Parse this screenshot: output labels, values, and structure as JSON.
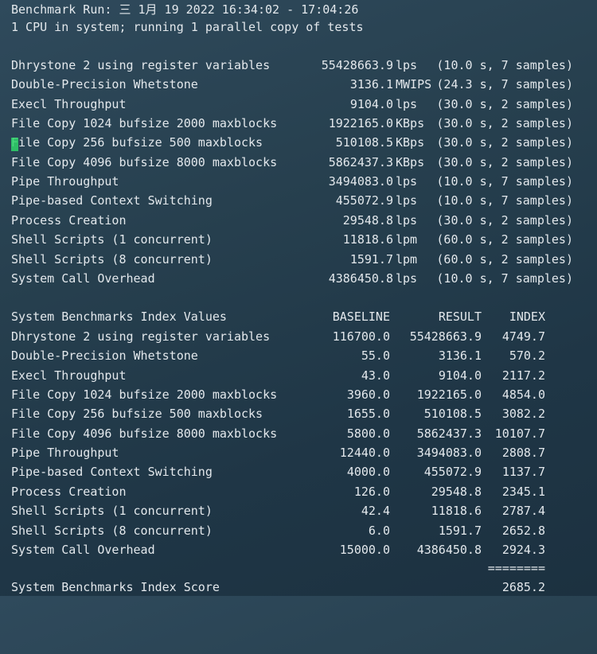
{
  "header": {
    "run_line": "Benchmark Run: 三 1月 19 2022 16:34:02 - 17:04:26",
    "cpu_line": "1 CPU in system; running 1 parallel copy of tests"
  },
  "results": [
    {
      "name": "Dhrystone 2 using register variables",
      "value": "55428663.9",
      "unit": "lps",
      "detail": "(10.0 s, 7 samples)"
    },
    {
      "name": "Double-Precision Whetstone",
      "value": "3136.1",
      "unit": "MWIPS",
      "detail": "(24.3 s, 7 samples)"
    },
    {
      "name": "Execl Throughput",
      "value": "9104.0",
      "unit": "lps",
      "detail": "(30.0 s, 2 samples)"
    },
    {
      "name": "File Copy 1024 bufsize 2000 maxblocks",
      "value": "1922165.0",
      "unit": "KBps",
      "detail": "(30.0 s, 2 samples)"
    },
    {
      "name": "File Copy 256 bufsize 500 maxblocks",
      "value": "510108.5",
      "unit": "KBps",
      "detail": "(30.0 s, 2 samples)"
    },
    {
      "name": "File Copy 4096 bufsize 8000 maxblocks",
      "value": "5862437.3",
      "unit": "KBps",
      "detail": "(30.0 s, 2 samples)"
    },
    {
      "name": "Pipe Throughput",
      "value": "3494083.0",
      "unit": "lps",
      "detail": "(10.0 s, 7 samples)"
    },
    {
      "name": "Pipe-based Context Switching",
      "value": "455072.9",
      "unit": "lps",
      "detail": "(10.0 s, 7 samples)"
    },
    {
      "name": "Process Creation",
      "value": "29548.8",
      "unit": "lps",
      "detail": "(30.0 s, 2 samples)"
    },
    {
      "name": "Shell Scripts (1 concurrent)",
      "value": "11818.6",
      "unit": "lpm",
      "detail": "(60.0 s, 2 samples)"
    },
    {
      "name": "Shell Scripts (8 concurrent)",
      "value": "1591.7",
      "unit": "lpm",
      "detail": "(60.0 s, 2 samples)"
    },
    {
      "name": "System Call Overhead",
      "value": "4386450.8",
      "unit": "lps",
      "detail": "(10.0 s, 7 samples)"
    }
  ],
  "index": {
    "header": {
      "title": "System Benchmarks Index Values",
      "baseline": "BASELINE",
      "result": "RESULT",
      "index": "INDEX"
    },
    "rows": [
      {
        "name": "Dhrystone 2 using register variables",
        "baseline": "116700.0",
        "result": "55428663.9",
        "index": "4749.7"
      },
      {
        "name": "Double-Precision Whetstone",
        "baseline": "55.0",
        "result": "3136.1",
        "index": "570.2"
      },
      {
        "name": "Execl Throughput",
        "baseline": "43.0",
        "result": "9104.0",
        "index": "2117.2"
      },
      {
        "name": "File Copy 1024 bufsize 2000 maxblocks",
        "baseline": "3960.0",
        "result": "1922165.0",
        "index": "4854.0"
      },
      {
        "name": "File Copy 256 bufsize 500 maxblocks",
        "baseline": "1655.0",
        "result": "510108.5",
        "index": "3082.2"
      },
      {
        "name": "File Copy 4096 bufsize 8000 maxblocks",
        "baseline": "5800.0",
        "result": "5862437.3",
        "index": "10107.7"
      },
      {
        "name": "Pipe Throughput",
        "baseline": "12440.0",
        "result": "3494083.0",
        "index": "2808.7"
      },
      {
        "name": "Pipe-based Context Switching",
        "baseline": "4000.0",
        "result": "455072.9",
        "index": "1137.7"
      },
      {
        "name": "Process Creation",
        "baseline": "126.0",
        "result": "29548.8",
        "index": "2345.1"
      },
      {
        "name": "Shell Scripts (1 concurrent)",
        "baseline": "42.4",
        "result": "11818.6",
        "index": "2787.4"
      },
      {
        "name": "Shell Scripts (8 concurrent)",
        "baseline": "6.0",
        "result": "1591.7",
        "index": "2652.8"
      },
      {
        "name": "System Call Overhead",
        "baseline": "15000.0",
        "result": "4386450.8",
        "index": "2924.3"
      }
    ],
    "separator": "========",
    "score_label": "System Benchmarks Index Score",
    "score_value": "2685.2"
  },
  "colors": {
    "background": "#27404f",
    "text": "#e3e8ec",
    "cursor": "#2fd36a"
  }
}
